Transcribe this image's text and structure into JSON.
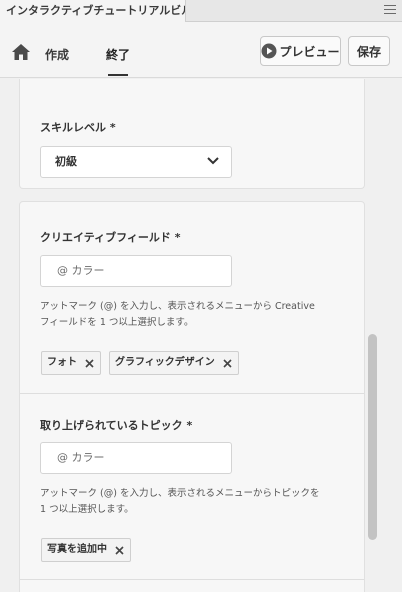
{
  "window": {
    "title": "インタラクティブチュートリアルビルダー"
  },
  "toolbar": {
    "home_icon": "home-icon",
    "tabs": [
      {
        "label": "作成"
      },
      {
        "label": "終了"
      }
    ],
    "preview_label": "プレビュー",
    "save_label": "保存"
  },
  "skill": {
    "label": "スキルレベル *",
    "value": "初級"
  },
  "creative_field": {
    "label": "クリエイティブフィールド *",
    "placeholder": "@ カラー",
    "help_line1": "アットマーク (@) を入力し、表示されるメニューから Creative",
    "help_line2": "フィールドを 1 つ以上選択します。",
    "tags": [
      "フォト",
      "グラフィックデザイン"
    ]
  },
  "topics": {
    "label": "取り上げられているトピック *",
    "placeholder": "@ カラー",
    "help_line1": "アットマーク (@) を入力し、表示されるメニューからトピックを",
    "help_line2": "1 つ以上選択します。",
    "tags": [
      "写真を追加中"
    ]
  },
  "colors": {
    "background": "#f0f0f0",
    "card": "#f7f7f7",
    "text": "#2c2c2c",
    "scrollbar": "#c3c3c3"
  }
}
